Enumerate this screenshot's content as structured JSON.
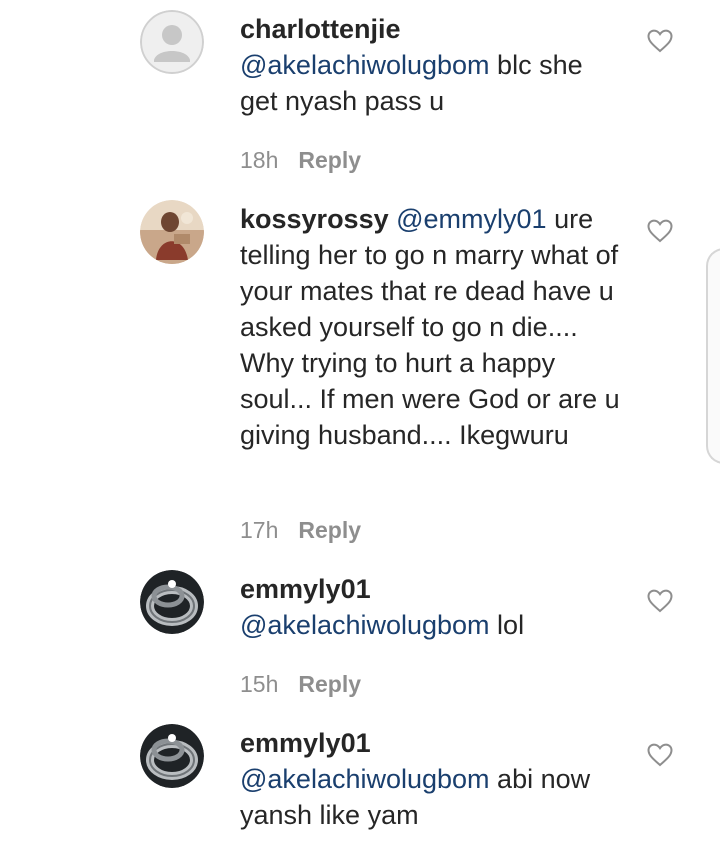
{
  "comments": [
    {
      "username": "charlottenjie",
      "mention": "@akelachiwolugbom",
      "text": " blc she get nyash pass u",
      "time": "18h",
      "reply_label": "Reply",
      "avatar": "default-avatar",
      "like_icon": "heart-outline-icon"
    },
    {
      "username": "kossyrossy",
      "mention": "@emmyly01",
      "text": " ure telling her to go n marry what of your mates that re dead have u asked yourself to go n die.... Why trying to hurt a happy soul... If men were God or are u giving husband.... Ikegwuru",
      "time": "17h",
      "reply_label": "Reply",
      "avatar": "photo-avatar",
      "like_icon": "heart-outline-icon"
    },
    {
      "username": "emmyly01",
      "mention": "@akelachiwolugbom",
      "text": " lol",
      "time": "15h",
      "reply_label": "Reply",
      "avatar": "ring-avatar",
      "like_icon": "heart-outline-icon"
    },
    {
      "username": "emmyly01",
      "mention": "@akelachiwolugbom",
      "text": " abi now yansh like yam",
      "avatar": "ring-avatar",
      "like_icon": "heart-outline-icon"
    }
  ],
  "colors": {
    "text": "#262626",
    "mention": "#1a3f6e",
    "meta": "#8e8e8e",
    "background": "#ffffff"
  }
}
